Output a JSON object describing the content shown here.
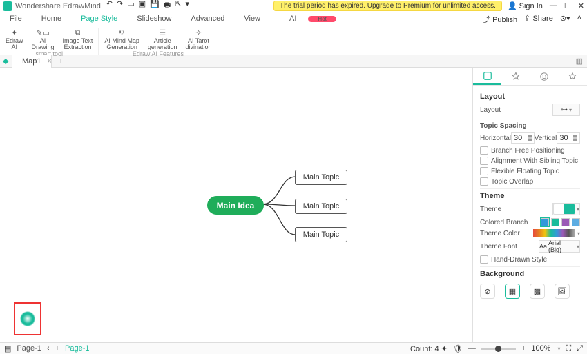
{
  "app": {
    "title": "Wondershare EdrawMind",
    "trial": "The trial period has expired. Upgrade to Premium for unlimited access.",
    "signin": "Sign In"
  },
  "menus": {
    "file": "File",
    "home": "Home",
    "pagestyle": "Page Style",
    "slideshow": "Slideshow",
    "advanced": "Advanced",
    "view": "View",
    "ai": "AI",
    "ai_badge": "Hot",
    "publish": "Publish",
    "share": "Share"
  },
  "ribbon": {
    "g1_label": "smart tool",
    "g2_label": "Edraw AI Features",
    "items": {
      "edrawai": "Edraw\nAI",
      "aidraw": "AI\nDrawing",
      "imgtxt": "Image Text\nExtraction",
      "mindgen": "AI Mind Map\nGeneration",
      "article": "Article\ngeneration",
      "tarot": "AI Tarot\ndivination"
    }
  },
  "tabs": {
    "map1": "Map1"
  },
  "mind": {
    "root": "Main Idea",
    "topic1": "Main Topic",
    "topic2": "Main Topic",
    "topic3": "Main Topic"
  },
  "panel": {
    "layout_title": "Layout",
    "layout_label": "Layout",
    "spacing_title": "Topic Spacing",
    "horizontal": "Horizontal",
    "vertical": "Vertical",
    "h_val": "30",
    "v_val": "30",
    "chk_free": "Branch Free Positioning",
    "chk_align": "Alignment With Sibling Topic",
    "chk_float": "Flexible Floating Topic",
    "chk_overlap": "Topic Overlap",
    "theme_title": "Theme",
    "theme_label": "Theme",
    "colored_branch": "Colored Branch",
    "theme_color": "Theme Color",
    "theme_font": "Theme Font",
    "font_val": "Arial (Big)",
    "hand": "Hand-Drawn Style",
    "bg_title": "Background"
  },
  "status": {
    "page1": "Page-1",
    "page_active": "Page-1",
    "count": "Count: 4",
    "zoom": "100%"
  }
}
